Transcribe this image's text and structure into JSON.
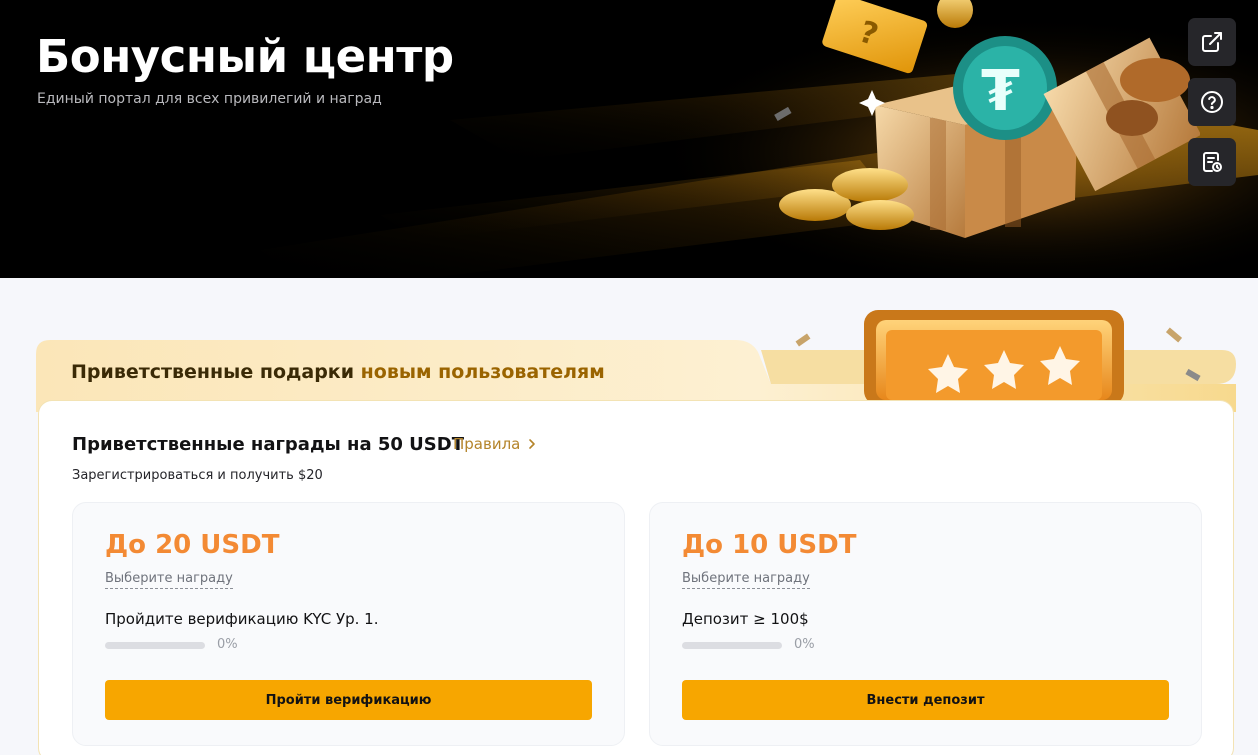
{
  "hero": {
    "title": "Бонусный центр",
    "subtitle": "Единый портал для всех привилегий и наград"
  },
  "side_actions": [
    {
      "icon": "external-link-icon"
    },
    {
      "icon": "question-icon"
    },
    {
      "icon": "records-icon"
    }
  ],
  "welcome": {
    "title_part1": "Приветственные подарки",
    "title_part2": "новым пользователям",
    "heading": "Приветственные награды на 50 USDT",
    "rules_label": "Правила",
    "subheading": "Зарегистрироваться и получить $20",
    "cards": [
      {
        "amount": "До 20 USDT",
        "choose_label": "Выберите награду",
        "task": "Пройдите верификацию KYC Ур. 1.",
        "progress": 0,
        "progress_label": "0%",
        "button_label": "Пройти верификацию"
      },
      {
        "amount": "До 10 USDT",
        "choose_label": "Выберите награду",
        "task": "Депозит ≥ 100$",
        "progress": 0,
        "progress_label": "0%",
        "button_label": "Внести депозит"
      }
    ]
  },
  "colors": {
    "accent": "#f7a600",
    "amount": "#f38a34",
    "rules": "#b4842a"
  }
}
